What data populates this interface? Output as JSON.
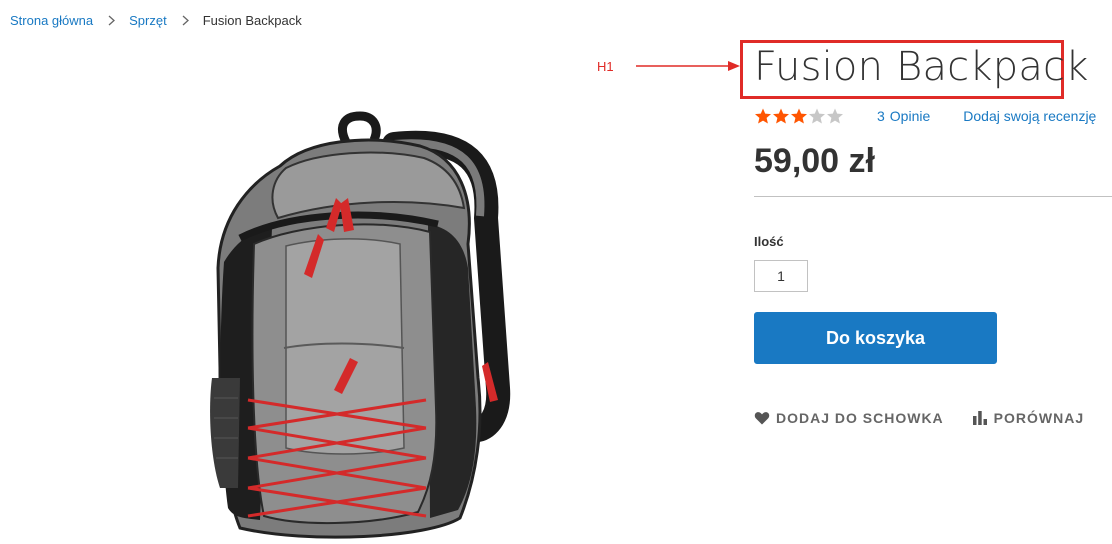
{
  "breadcrumb": {
    "items": [
      {
        "label": "Strona główna"
      },
      {
        "label": "Sprzęt"
      }
    ],
    "current": "Fusion Backpack"
  },
  "annotation": {
    "label": "H1",
    "color": "#e02b27"
  },
  "product": {
    "title": "Fusion Backpack",
    "rating": {
      "value": 3,
      "max": 5,
      "filled_color": "#ff5501",
      "empty_color": "#c7c7c7"
    },
    "reviews": {
      "count": "3",
      "label": "Opinie"
    },
    "add_review_label": "Dodaj swoją recenzję",
    "price": "59,00 zł",
    "qty_label": "Ilość",
    "qty_value": "1",
    "add_to_cart_label": "Do koszyka",
    "actions": [
      {
        "label": "DODAJ DO SCHOWKA",
        "icon": "heart-icon"
      },
      {
        "label": "PORÓWNAJ",
        "icon": "compare-icon"
      },
      {
        "label": "",
        "icon": "email-icon"
      }
    ]
  },
  "colors": {
    "link": "#1979c3",
    "primary_button": "#1979c3",
    "text": "#333333"
  }
}
